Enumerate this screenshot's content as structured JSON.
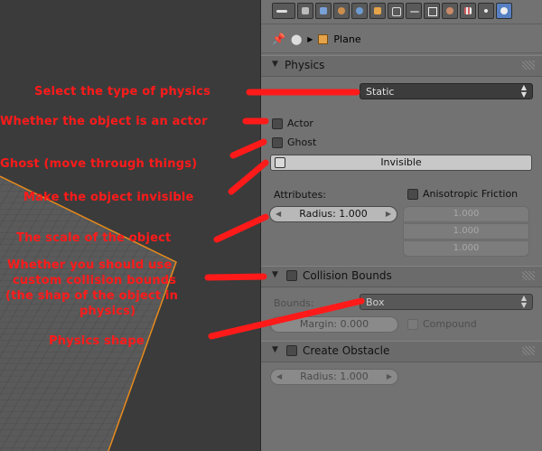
{
  "colors": {
    "annotation": "#ff1a1a",
    "active_tab": "#5680c2",
    "panel_bg": "#727272"
  },
  "toolbar_icons": [
    "view-menu-icon",
    "render-icon",
    "render-layers-icon",
    "scene-icon",
    "world-icon",
    "object-icon",
    "constraints-icon",
    "modifiers-icon",
    "data-icon",
    "material-icon",
    "texture-icon",
    "particles-icon",
    "physics-icon"
  ],
  "breadcrumb": {
    "object_name": "Plane"
  },
  "physics": {
    "title": "Physics",
    "type_value": "Static",
    "actor_label": "Actor",
    "ghost_label": "Ghost",
    "invisible_label": "Invisible",
    "attributes_label": "Attributes:",
    "anisotropic_label": "Anisotropic Friction",
    "radius_value": "Radius: 1.000",
    "aniso_values": [
      "1.000",
      "1.000",
      "1.000"
    ]
  },
  "collision": {
    "title": "Collision Bounds",
    "bounds_label": "Bounds:",
    "bounds_value": "Box",
    "margin_value": "Margin: 0.000",
    "compound_label": "Compound"
  },
  "obstacle": {
    "title": "Create Obstacle",
    "radius_value": "Radius: 1.000"
  },
  "annotations": {
    "type": "Select the type of physics",
    "actor": "Whether the object is an actor",
    "ghost": "Ghost (move through things)",
    "invisible": "Make the object invisible",
    "scale": "The scale of the object",
    "bounds_1": "Whether you should use",
    "bounds_2": "custom collision bounds",
    "bounds_3": "(the shap of the object in",
    "bounds_4": "physics)",
    "shape": "Physics shape"
  }
}
